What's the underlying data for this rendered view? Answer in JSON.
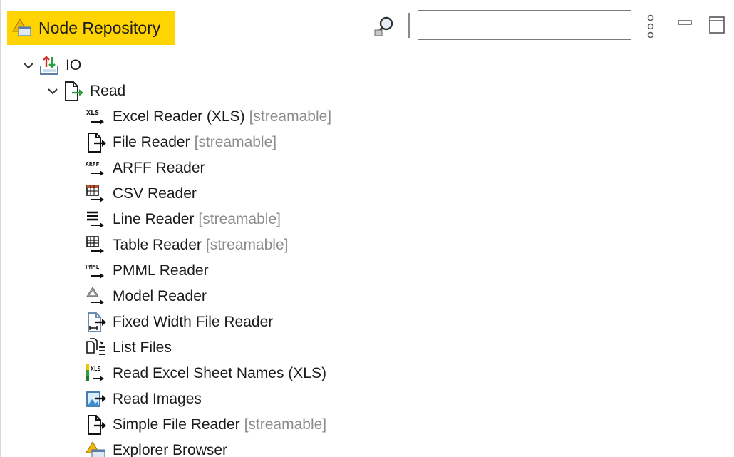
{
  "header": {
    "title": "Node Repository",
    "search_value": "",
    "search_placeholder": ""
  },
  "tree": {
    "category": {
      "label": "IO",
      "icon": "io-category-icon",
      "expanded": true
    },
    "subcategory": {
      "label": "Read",
      "icon": "read-category-icon",
      "expanded": true
    },
    "nodes": [
      {
        "label": "Excel Reader (XLS)",
        "tag": "[streamable]",
        "icon": "xls-reader-icon"
      },
      {
        "label": "File Reader",
        "tag": "[streamable]",
        "icon": "file-reader-icon"
      },
      {
        "label": "ARFF Reader",
        "tag": "",
        "icon": "arff-reader-icon"
      },
      {
        "label": "CSV Reader",
        "tag": "",
        "icon": "csv-reader-icon"
      },
      {
        "label": "Line Reader",
        "tag": "[streamable]",
        "icon": "line-reader-icon"
      },
      {
        "label": "Table Reader",
        "tag": "[streamable]",
        "icon": "table-reader-icon"
      },
      {
        "label": "PMML Reader",
        "tag": "",
        "icon": "pmml-reader-icon"
      },
      {
        "label": "Model Reader",
        "tag": "",
        "icon": "model-reader-icon"
      },
      {
        "label": "Fixed Width File Reader",
        "tag": "",
        "icon": "fixed-width-reader-icon"
      },
      {
        "label": "List Files",
        "tag": "",
        "icon": "list-files-icon"
      },
      {
        "label": "Read Excel Sheet Names (XLS)",
        "tag": "",
        "icon": "excel-sheet-names-icon"
      },
      {
        "label": "Read Images",
        "tag": "",
        "icon": "read-images-icon"
      },
      {
        "label": "Simple File Reader",
        "tag": "[streamable]",
        "icon": "simple-file-reader-icon"
      },
      {
        "label": "Explorer Browser",
        "tag": "",
        "icon": "explorer-browser-icon"
      }
    ]
  },
  "colors": {
    "tab_highlight": "#ffd400",
    "streamable_text": "#8c8c8c",
    "arrow_green": "#2e9e3e"
  }
}
